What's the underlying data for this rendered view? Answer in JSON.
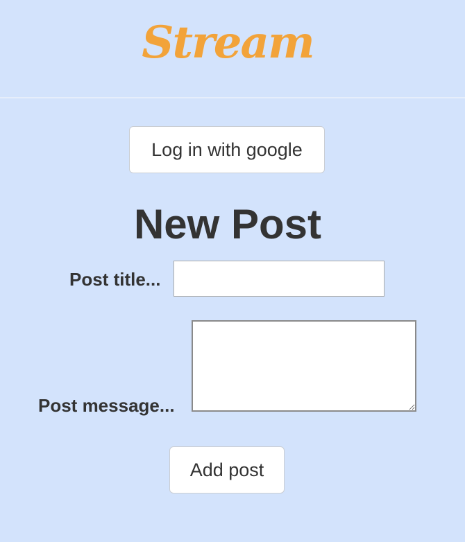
{
  "header": {
    "logo_text": "Stream"
  },
  "auth": {
    "login_label": "Log in with google"
  },
  "new_post": {
    "heading": "New Post",
    "title_label": "Post title...",
    "title_value": "",
    "message_label": "Post message...",
    "message_value": "",
    "submit_label": "Add post"
  },
  "colors": {
    "background": "#d3e3fc",
    "logo": "#f2a33a",
    "text": "#333333"
  }
}
